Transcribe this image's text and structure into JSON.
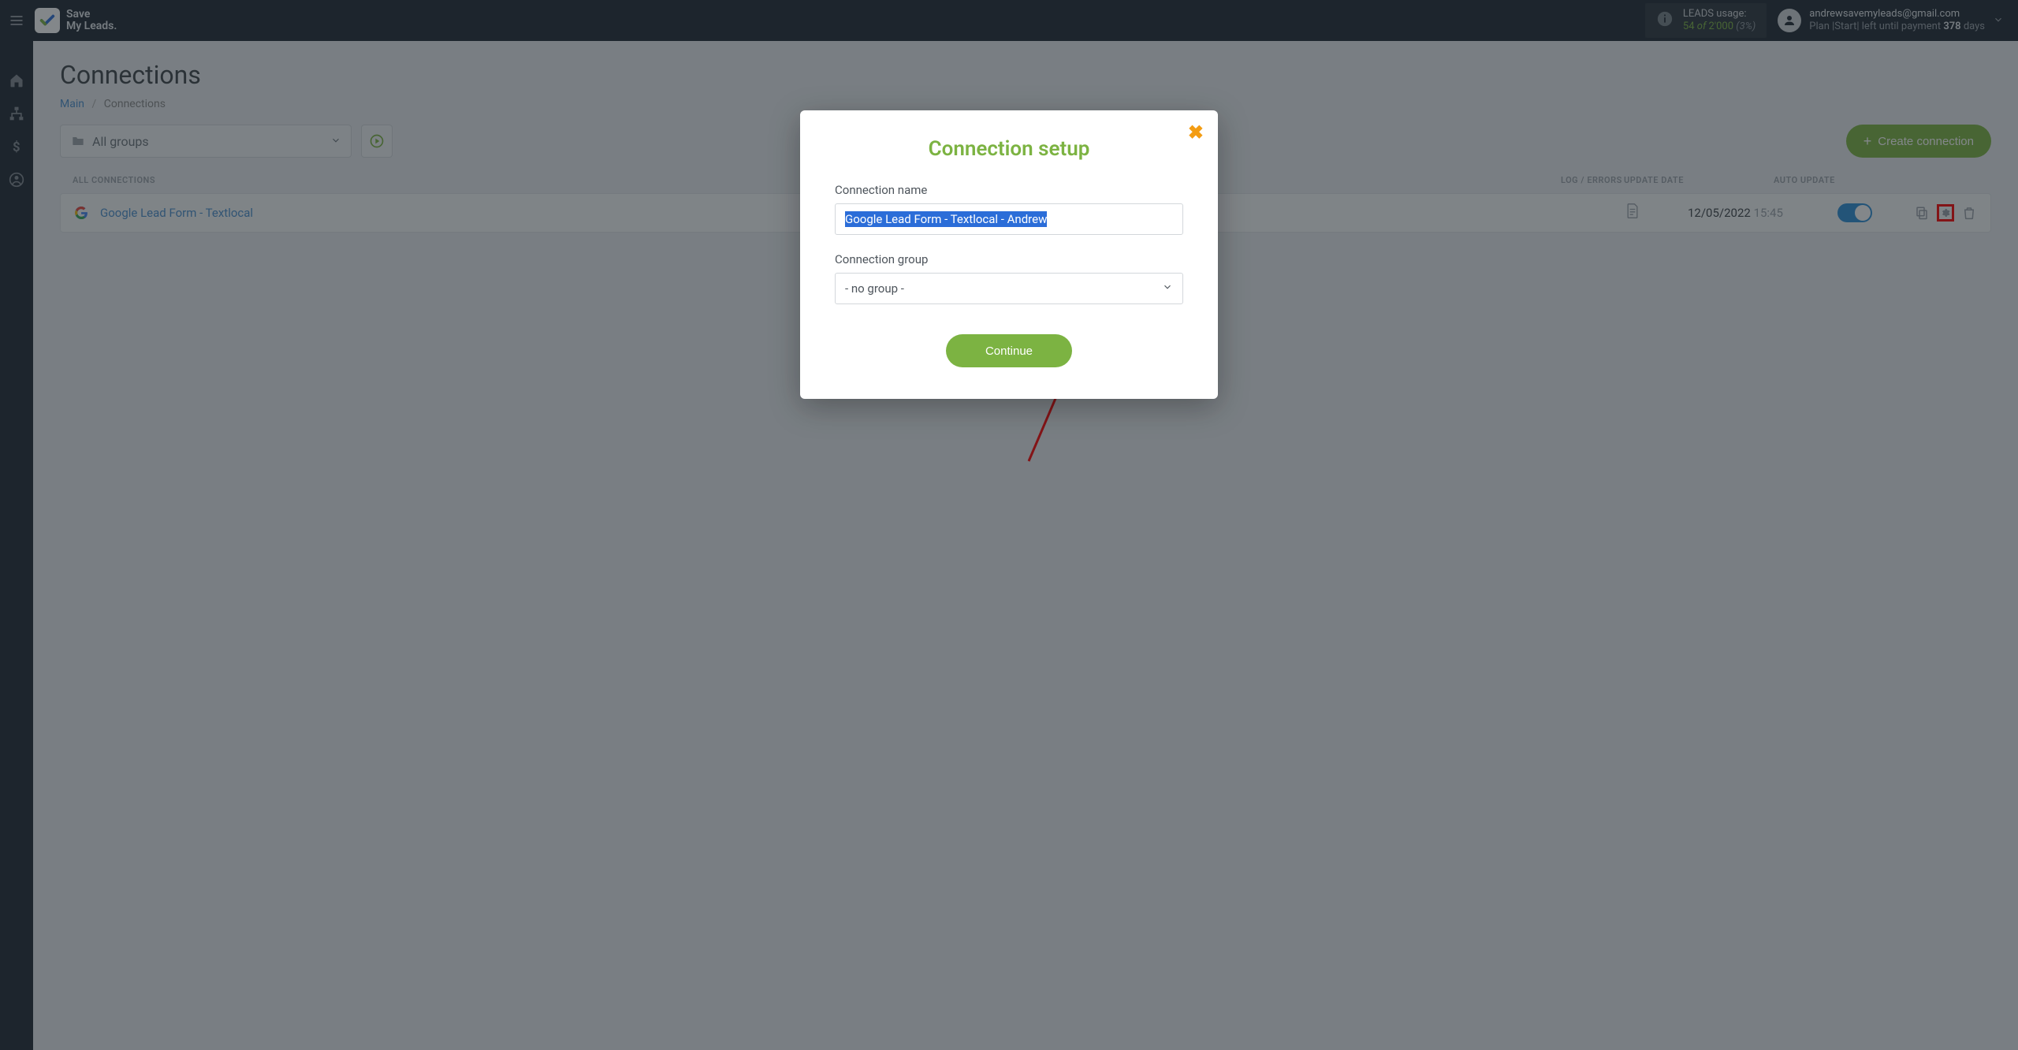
{
  "brand": {
    "line1": "Save",
    "line2": "My Leads."
  },
  "usage": {
    "label": "LEADS usage:",
    "current": "54",
    "of_word": "of",
    "max": "2'000",
    "pct": "(3%)"
  },
  "user": {
    "email": "andrewsavemyleads@gmail.com",
    "plan_prefix": "Plan |Start| left until payment ",
    "days_num": "378",
    "days_suffix": " days"
  },
  "page": {
    "title": "Connections",
    "breadcrumb_main": "Main",
    "breadcrumb_current": "Connections"
  },
  "toolbar": {
    "group_label": "All groups",
    "create_label": "Create connection"
  },
  "table": {
    "col_all": "ALL CONNECTIONS",
    "col_log": "LOG / ERRORS",
    "col_date": "UPDATE DATE",
    "col_auto": "AUTO UPDATE"
  },
  "row": {
    "name": "Google Lead Form - Textlocal",
    "date": "12/05/2022",
    "time": "15:45"
  },
  "modal": {
    "title": "Connection setup",
    "name_label": "Connection name",
    "name_value": "Google Lead Form - Textlocal - Andrew",
    "group_label": "Connection group",
    "group_value": "- no group -",
    "continue": "Continue"
  }
}
